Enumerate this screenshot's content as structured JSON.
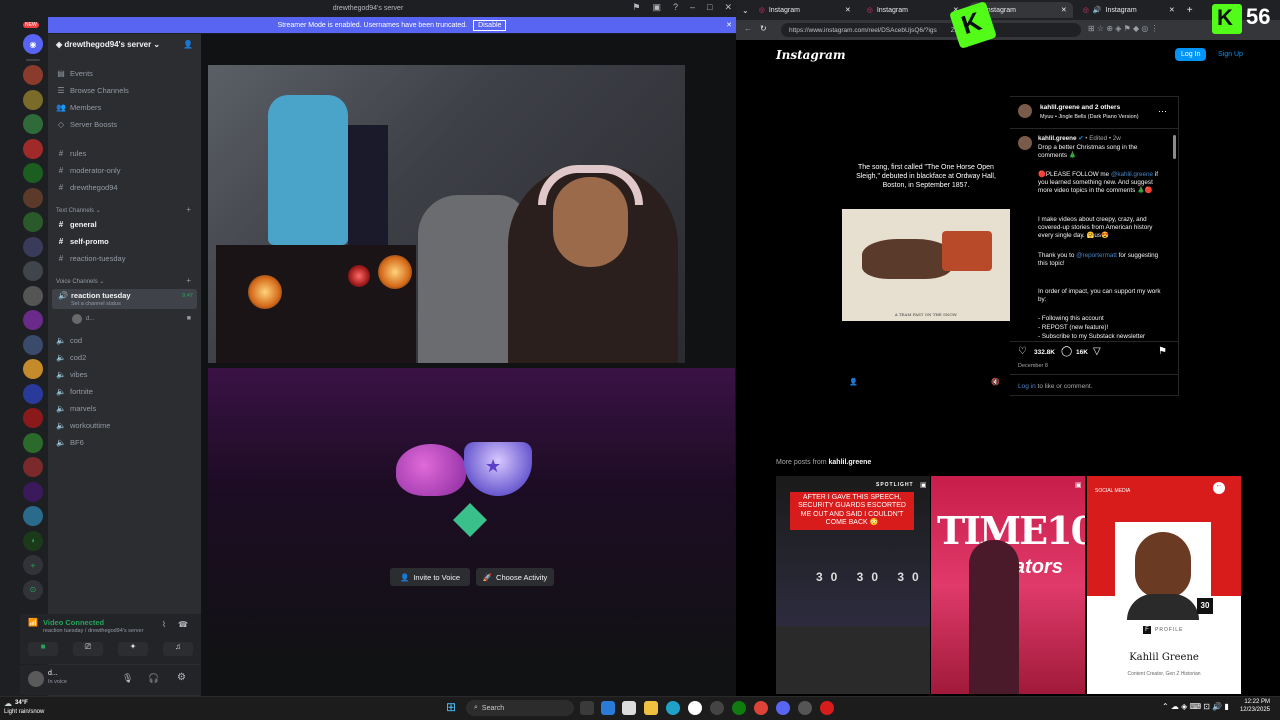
{
  "discord": {
    "window_title": "drewthegod94's server",
    "streamer_banner": "Streamer Mode is enabled. Usernames have been truncated.",
    "streamer_button": "Disable",
    "new_badge": "NEW",
    "server_name": "drewthegod94's server",
    "top_items": [
      {
        "label": "Events",
        "icon": "calendar-icon"
      },
      {
        "label": "Browse Channels",
        "icon": "list-icon"
      },
      {
        "label": "Members",
        "icon": "members-icon"
      },
      {
        "label": "Server Boosts",
        "icon": "boost-icon"
      }
    ],
    "text_top": [
      "rules",
      "moderator-only",
      "drewthegod94"
    ],
    "text_category": "Text Channels",
    "text_channels": [
      "general",
      "self-promo",
      "reaction-tuesday"
    ],
    "voice_category": "Voice Channels",
    "active_voice": {
      "name": "reaction tuesday",
      "status": "Set a channel status",
      "timer": "9:47",
      "member": "d..."
    },
    "voice_channels": [
      "cod",
      "cod2",
      "vibes",
      "fortnite",
      "marvels",
      "workouttime",
      "BF6"
    ],
    "vc_status": "Video Connected",
    "vc_location": "reaction tuesday / drewthegod94's server",
    "user_name": "d...",
    "user_status": "In voice",
    "invite_label": "Invite to Voice",
    "activity_label": "Choose Activity"
  },
  "browser": {
    "tabs": [
      "Instagram",
      "Instagram",
      "Instagram",
      "Instagram"
    ],
    "url_left": "https://www.instagram.com/reel/DSAcebUjsQ6/?igs",
    "url_right": "ZicTV5",
    "stream_number": "56"
  },
  "instagram": {
    "logo": "Instagram",
    "login": "Log In",
    "signup": "Sign Up",
    "author_line": "kahlil.greene and 2 others",
    "audio": "Myuu • Jingle Bells (Dark Piano Version)",
    "reel_caption": "The song, first called \"The One Horse Open Sleigh,\" debuted in blackface at Ordway Hall, Boston, in September 1857.",
    "print_caption": "A TEAM FAST ON THE SNOW.",
    "comment_user": "kahlil.greene",
    "comment_edited": "• Edited • 2w",
    "comment_1": "Drop a better Christmas song in the comments 🎄",
    "comment_2a": "🔴PLEASE FOLLOW me ",
    "comment_2_link": "@kahlil.greene",
    "comment_2b": " if you learned something new. And suggest more video topics in the comments 🎄🔴",
    "comment_3": "I make videos about creepy, crazy, and covered-up stories from American history every single day. 🤗us😍",
    "comment_4a": "Thank you to ",
    "comment_4_link": "@reportermatt",
    "comment_4b": " for suggesting this topic!",
    "comment_5": "In order of impact, you can support my work by:",
    "comment_6": "- Following this account",
    "comment_7": "- REPOST (new feature)!",
    "comment_8": "- Subscribe to my Substack newsletter",
    "likes": "332.8K",
    "comments": "16K",
    "date": "December 8",
    "login_prompt_link": "Log in",
    "login_prompt": " to like or comment.",
    "more_posts_prefix": "More posts from ",
    "more_posts_user": "kahlil.greene",
    "thumb1_text": "AFTER I GAVE THIS SPEECH, SECURITY GUARDS ESCORTED ME OUT AND SAID I COULDN'T COME BACK 😳",
    "thumb1_sign": "SPOTLIGHT",
    "thumb2_title": "TIME100",
    "thumb2_sub": "reators",
    "thumb3_header": "SOCIAL MEDIA",
    "thumb3_name": "Kahlil Greene",
    "thumb3_role": "Content Creator, Gen Z Historian",
    "thumb3_profile": "PROFILE",
    "thumb3_30": "30"
  },
  "taskbar": {
    "search": "Search",
    "weather_temp": "34°F",
    "weather_desc": "Light rain/snow",
    "time": "12:22 PM",
    "date": "12/23/2025"
  },
  "colors": {
    "discord_blurple": "#5865f2",
    "ig_blue": "#0095f6",
    "green": "#23a55a"
  }
}
